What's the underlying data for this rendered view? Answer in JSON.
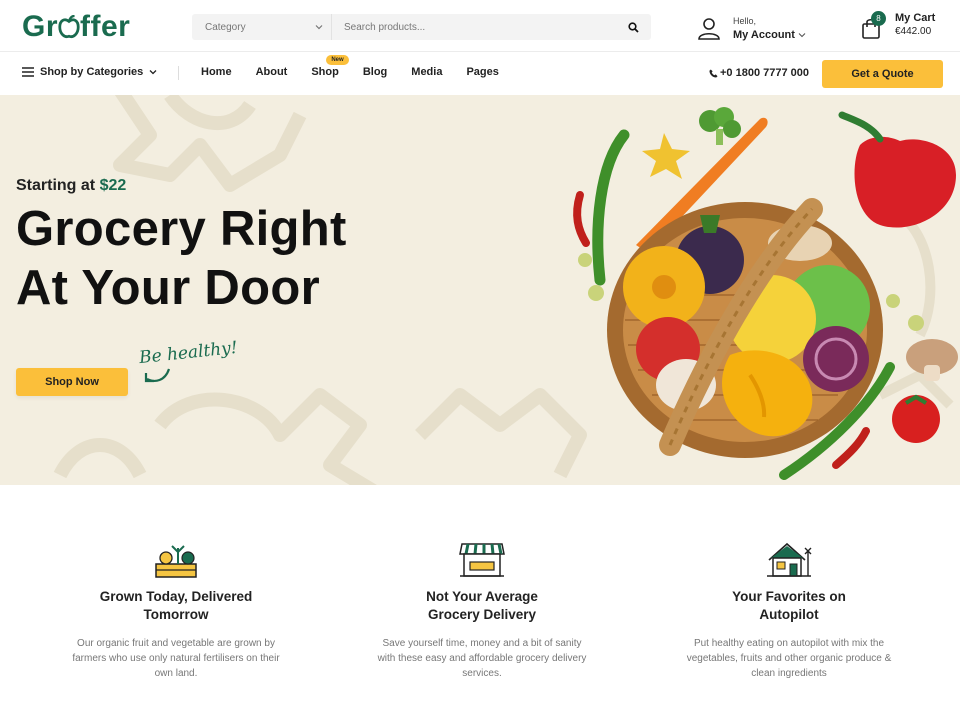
{
  "brand": {
    "logo_prefix": "Gr",
    "logo_suffix": "ffer",
    "accent": "#1a6b4f",
    "yellow": "#fbbf3a"
  },
  "search": {
    "category_label": "Category",
    "placeholder": "Search products..."
  },
  "account": {
    "greeting": "Hello,",
    "label": "My Account"
  },
  "cart": {
    "label": "My Cart",
    "amount": "€442.00",
    "count": "8"
  },
  "nav": {
    "categories_label": "Shop by Categories",
    "links": [
      "Home",
      "About",
      "Shop",
      "Blog",
      "Media",
      "Pages"
    ],
    "new_badge": "New",
    "phone": "+0 1800 7777 000",
    "quote_button": "Get a Quote"
  },
  "hero": {
    "starting_text": "Starting at",
    "price": "$22",
    "title_line1": "Grocery Right",
    "title_line2": "At Your Door",
    "shop_button": "Shop Now",
    "script_text": "Be healthy!",
    "background": "#f3eee0"
  },
  "features": [
    {
      "icon": "crate-produce-icon",
      "title_line1": "Grown Today, Delivered",
      "title_line2": "Tomorrow",
      "desc_line1": "Our organic fruit and vegetable are grown by",
      "desc_line2": "farmers who use only natural fertilisers on their",
      "desc_line3": "own land."
    },
    {
      "icon": "storefront-icon",
      "title_line1": "Not Your Average",
      "title_line2": "Grocery Delivery",
      "desc_line1": "Save yourself time, money and a bit of sanity",
      "desc_line2": "with these easy and affordable grocery delivery",
      "desc_line3": "services."
    },
    {
      "icon": "farmhouse-icon",
      "title_line1": "Your Favorites on",
      "title_line2": "Autopilot",
      "desc_line1": "Put healthy eating on autopilot with mix the",
      "desc_line2": "vegetables, fruits and other organic produce &",
      "desc_line3": "clean ingredients"
    }
  ]
}
